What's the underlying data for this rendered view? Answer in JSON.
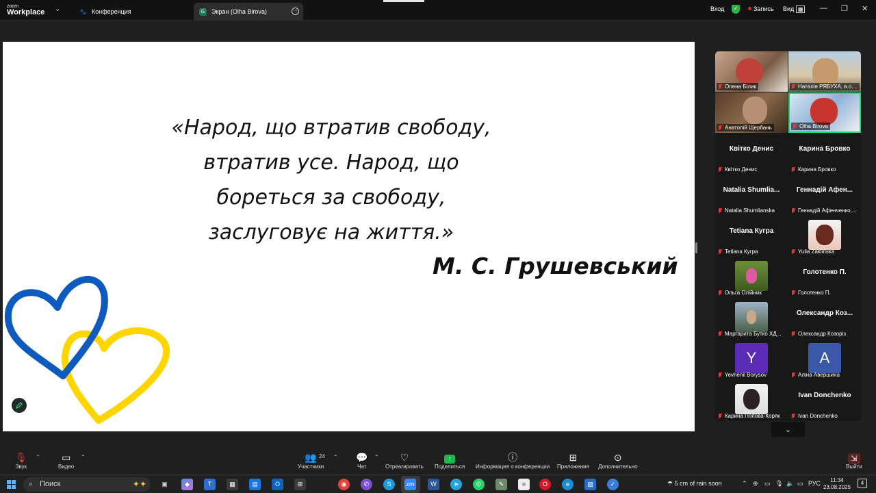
{
  "app": {
    "logo_line1": "zoom",
    "logo_line2": "Workplace"
  },
  "tabs": [
    {
      "label": "Конференция",
      "icon": "paw-icon"
    },
    {
      "label": "Экран (Olha Birova)",
      "icon_letter": "G"
    }
  ],
  "topbar": {
    "signin": "Вход",
    "record": "Запись",
    "view": "Вид",
    "shield_color": "#2ab34b"
  },
  "slide": {
    "quote_lines": [
      "«Народ, що втратив свободу,",
      "втратив усе. Народ, що",
      "бореться за свободу,",
      "заслуговує на життя.»"
    ],
    "author": "М. С. Грушевський",
    "heart_colors": {
      "blue": "#0d5bbf",
      "yellow": "#ffd500"
    }
  },
  "participants": [
    {
      "name": "Олена Білик",
      "type": "video"
    },
    {
      "name": "Наталія РЯБУХА, в.о....",
      "type": "video"
    },
    {
      "name": "Анатолій Щербань",
      "type": "video"
    },
    {
      "name": "Olha Birova",
      "type": "video",
      "active": true
    },
    {
      "display": "Квітко Денис",
      "name": "Квітко Денис",
      "type": "name"
    },
    {
      "display": "Карина Бровко",
      "name": "Карина Бровко",
      "type": "name"
    },
    {
      "display": "Natalia Shumlia...",
      "name": "Natalia Shumlianska",
      "type": "name"
    },
    {
      "display": "Геннадій Афен...",
      "name": "Геннадій Афенченко,...",
      "type": "name"
    },
    {
      "display": "Tetiana Кугра",
      "name": "Tetiana Кугра",
      "type": "name"
    },
    {
      "name": "Yulia Zaklinska",
      "type": "photo"
    },
    {
      "name": "Ольга Олійник",
      "type": "photo"
    },
    {
      "display": "Голотенко П.",
      "name": "Голотенко П.",
      "type": "name"
    },
    {
      "name": "Маргарита Бутко ХД...",
      "type": "photo"
    },
    {
      "display": "Олександр Коз...",
      "name": "Олександр Козоріз",
      "type": "name"
    },
    {
      "name": "Yevhenii Borysov",
      "type": "letter",
      "letter": "Y",
      "color": "#5b2bb5"
    },
    {
      "name": "Аліна Авершина",
      "type": "letter",
      "letter": "A",
      "color": "#3a57a8"
    },
    {
      "name": "Карина Попова-Коряк",
      "type": "photo"
    },
    {
      "display": "Ivan Donchenko",
      "name": "Ivan Donchenko",
      "type": "name"
    }
  ],
  "controls": {
    "audio": "Звук",
    "video": "Видео",
    "participants": "Участники",
    "participants_count": "24",
    "chat": "Чат",
    "react": "Отреагировать",
    "share": "Поделиться",
    "info": "Информация о конференции",
    "apps": "Приложения",
    "more": "Дополнительно",
    "leave": "Выйти"
  },
  "taskbar": {
    "search_placeholder": "Поиск",
    "weather": "5 cm of rain soon",
    "lang": "РУС",
    "time": "11:34",
    "date": "23.08.2025",
    "notifications": "4"
  }
}
